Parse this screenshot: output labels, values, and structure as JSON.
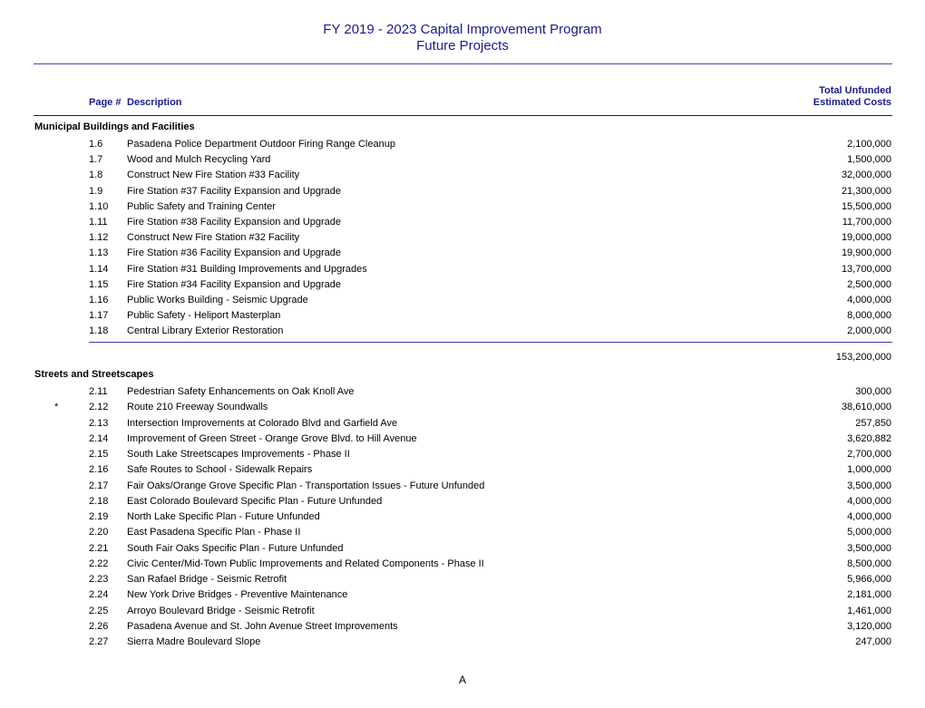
{
  "header": {
    "title_line1": "FY 2019 - 2023 Capital Improvement Program",
    "title_line2": "Future Projects"
  },
  "columns": {
    "page": "Page #",
    "description": "Description",
    "cost_line1": "Total Unfunded",
    "cost_line2": "Estimated Costs"
  },
  "sections": [
    {
      "name": "Municipal Buildings and Facilities",
      "rows": [
        {
          "mark": "",
          "page": "1.6",
          "description": "Pasadena Police Department Outdoor Firing Range Cleanup",
          "cost": "2,100,000"
        },
        {
          "mark": "",
          "page": "1.7",
          "description": "Wood and Mulch Recycling Yard",
          "cost": "1,500,000"
        },
        {
          "mark": "",
          "page": "1.8",
          "description": "Construct New Fire Station #33 Facility",
          "cost": "32,000,000"
        },
        {
          "mark": "",
          "page": "1.9",
          "description": "Fire Station #37 Facility Expansion and Upgrade",
          "cost": "21,300,000"
        },
        {
          "mark": "",
          "page": "1.10",
          "description": "Public Safety and Training Center",
          "cost": "15,500,000"
        },
        {
          "mark": "",
          "page": "1.11",
          "description": "Fire Station #38 Facility Expansion and Upgrade",
          "cost": "11,700,000"
        },
        {
          "mark": "",
          "page": "1.12",
          "description": "Construct New Fire Station #32 Facility",
          "cost": "19,000,000"
        },
        {
          "mark": "",
          "page": "1.13",
          "description": "Fire Station #36 Facility Expansion and Upgrade",
          "cost": "19,900,000"
        },
        {
          "mark": "",
          "page": "1.14",
          "description": "Fire Station #31 Building Improvements and Upgrades",
          "cost": "13,700,000"
        },
        {
          "mark": "",
          "page": "1.15",
          "description": "Fire Station #34 Facility Expansion and Upgrade",
          "cost": "2,500,000"
        },
        {
          "mark": "",
          "page": "1.16",
          "description": "Public Works Building - Seismic Upgrade",
          "cost": "4,000,000"
        },
        {
          "mark": "",
          "page": "1.17",
          "description": "Public Safety - Heliport Masterplan",
          "cost": "8,000,000"
        },
        {
          "mark": "",
          "page": "1.18",
          "description": "Central Library Exterior Restoration",
          "cost": "2,000,000"
        }
      ],
      "subtotal": "153,200,000"
    },
    {
      "name": "Streets and Streetscapes",
      "rows": [
        {
          "mark": "",
          "page": "2.11",
          "description": "Pedestrian Safety Enhancements on Oak Knoll Ave",
          "cost": "300,000"
        },
        {
          "mark": "*",
          "page": "2.12",
          "description": "Route 210 Freeway Soundwalls",
          "cost": "38,610,000"
        },
        {
          "mark": "",
          "page": "2.13",
          "description": "Intersection Improvements at Colorado Blvd and Garfield Ave",
          "cost": "257,850"
        },
        {
          "mark": "",
          "page": "2.14",
          "description": "Improvement of Green Street - Orange Grove Blvd. to Hill Avenue",
          "cost": "3,620,882"
        },
        {
          "mark": "",
          "page": "2.15",
          "description": "South Lake Streetscapes Improvements - Phase II",
          "cost": "2,700,000"
        },
        {
          "mark": "",
          "page": "2.16",
          "description": "Safe Routes to School - Sidewalk Repairs",
          "cost": "1,000,000"
        },
        {
          "mark": "",
          "page": "2.17",
          "description": "Fair Oaks/Orange Grove Specific Plan - Transportation Issues - Future Unfunded",
          "cost": "3,500,000"
        },
        {
          "mark": "",
          "page": "2.18",
          "description": "East Colorado Boulevard Specific Plan - Future Unfunded",
          "cost": "4,000,000"
        },
        {
          "mark": "",
          "page": "2.19",
          "description": "North Lake Specific Plan - Future Unfunded",
          "cost": "4,000,000"
        },
        {
          "mark": "",
          "page": "2.20",
          "description": "East Pasadena Specific Plan - Phase II",
          "cost": "5,000,000"
        },
        {
          "mark": "",
          "page": "2.21",
          "description": "South Fair Oaks Specific Plan - Future Unfunded",
          "cost": "3,500,000"
        },
        {
          "mark": "",
          "page": "2.22",
          "description": "Civic Center/Mid-Town Public Improvements and Related Components - Phase II",
          "cost": "8,500,000"
        },
        {
          "mark": "",
          "page": "2.23",
          "description": "San Rafael Bridge - Seismic Retrofit",
          "cost": "5,966,000"
        },
        {
          "mark": "",
          "page": "2.24",
          "description": "New York Drive Bridges - Preventive Maintenance",
          "cost": "2,181,000"
        },
        {
          "mark": "",
          "page": "2.25",
          "description": "Arroyo Boulevard Bridge - Seismic Retrofit",
          "cost": "1,461,000"
        },
        {
          "mark": "",
          "page": "2.26",
          "description": "Pasadena Avenue and St. John Avenue Street Improvements",
          "cost": "3,120,000"
        },
        {
          "mark": "",
          "page": "2.27",
          "description": "Sierra Madre Boulevard Slope",
          "cost": "247,000"
        }
      ]
    }
  ],
  "footer": {
    "page_label": "A"
  }
}
